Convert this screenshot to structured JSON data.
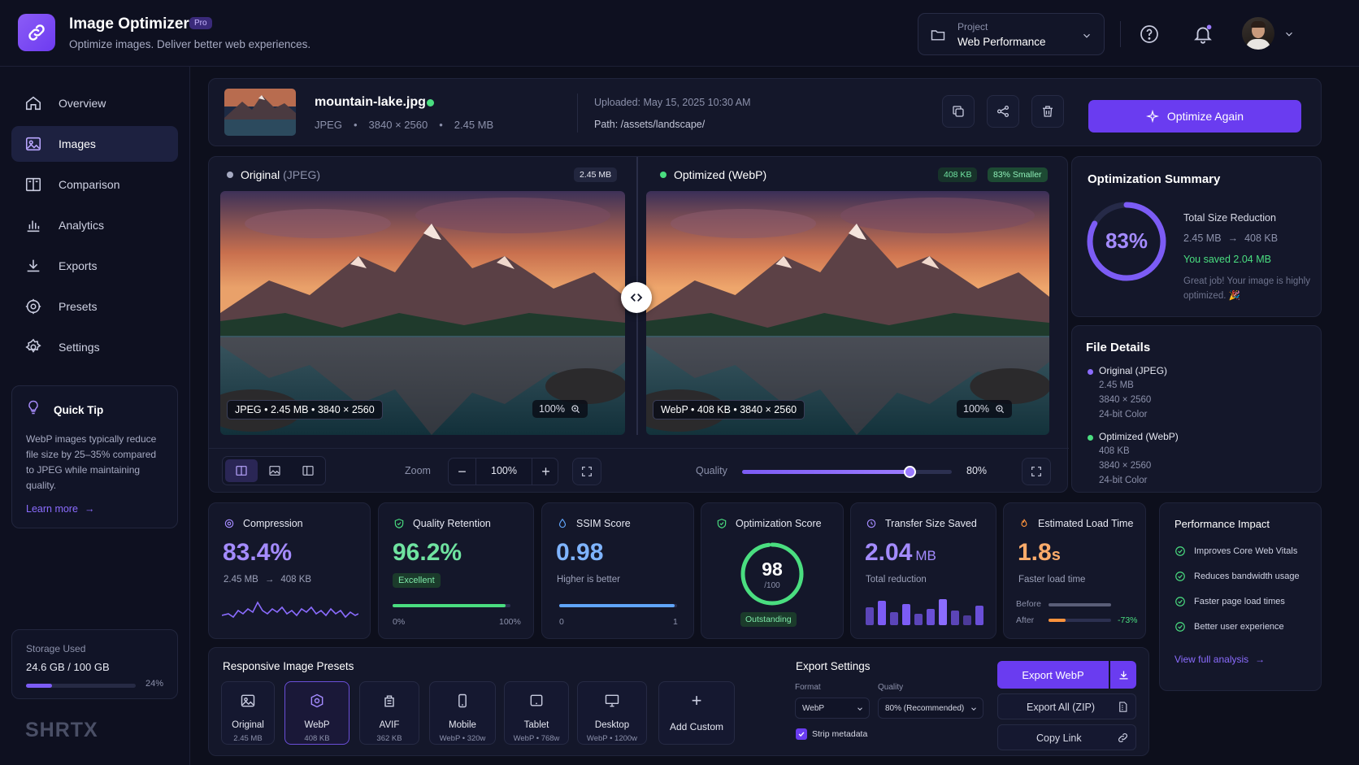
{
  "app": {
    "title": "Image Optimizer",
    "badge": "Pro",
    "subtitle": "Optimize images. Deliver better web experiences."
  },
  "project": {
    "label": "Project",
    "name": "Web Performance"
  },
  "nav": {
    "overview": "Overview",
    "images": "Images",
    "comparison": "Comparison",
    "analytics": "Analytics",
    "exports": "Exports",
    "presets": "Presets",
    "settings": "Settings"
  },
  "tip": {
    "title": "Quick Tip",
    "body": "WebP images typically reduce file size by 25–35% compared to JPEG while maintaining quality.",
    "link": "Learn more"
  },
  "storage": {
    "label": "Storage Used",
    "value": "24.6 GB / 100 GB",
    "percent": "24%",
    "fraction": 0.24
  },
  "brand": "SHRTX",
  "file": {
    "name": "mountain-lake.jpg",
    "format": "JPEG",
    "dims": "3840 × 2560",
    "size": "2.45 MB",
    "uploaded": "Uploaded: May 15, 2025 10:30 AM",
    "path": "Path: /assets/landscape/"
  },
  "actions": {
    "optimize_again": "Optimize Again"
  },
  "compare": {
    "original": {
      "label": "Original",
      "format": "(JPEG)",
      "size": "2.45 MB",
      "info": "JPEG  •  2.45 MB  •  3840 × 2560",
      "zoom": "100%"
    },
    "optimized": {
      "label": "Optimized (WebP)",
      "size": "408 KB",
      "smaller": "83% Smaller",
      "info": "WebP  •  408 KB  •  3840 × 2560",
      "zoom": "100%"
    }
  },
  "toolbar": {
    "zoom_label": "Zoom",
    "zoom_value": "100%",
    "quality_label": "Quality",
    "quality_value": "80%",
    "quality_fraction": 0.8
  },
  "summary": {
    "title": "Optimization Summary",
    "percent": "83%",
    "fraction": 0.83,
    "reduction_label": "Total Size Reduction",
    "before": "2.45 MB",
    "after": "408 KB",
    "saved": "You saved 2.04 MB",
    "note": "Great job! Your image is highly optimized. 🎉"
  },
  "details": {
    "title": "File Details",
    "original": {
      "name": "Original (JPEG)",
      "size": "2.45 MB",
      "dims": "3840 × 2560",
      "color": "24-bit Color"
    },
    "optimized": {
      "name": "Optimized (WebP)",
      "size": "408 KB",
      "dims": "3840 × 2560",
      "color": "24-bit Color"
    }
  },
  "metrics": {
    "compression": {
      "title": "Compression",
      "value": "83.4%",
      "before": "2.45 MB",
      "after": "408 KB"
    },
    "quality": {
      "title": "Quality Retention",
      "value": "96.2%",
      "badge": "Excellent",
      "min": "0%",
      "max": "100%",
      "fraction": 0.962
    },
    "ssim": {
      "title": "SSIM Score",
      "value": "0.98",
      "sub": "Higher is better",
      "min": "0",
      "max": "1",
      "fraction": 0.98
    },
    "opt_score": {
      "title": "Optimization Score",
      "value": "98",
      "denom": "/100",
      "badge": "Outstanding",
      "fraction": 0.98
    },
    "transfer": {
      "title": "Transfer Size Saved",
      "value": "2.04",
      "unit": "MB",
      "sub": "Total reduction"
    },
    "load": {
      "title": "Estimated Load Time",
      "value": "1.8",
      "unit": "s",
      "sub": "Faster load time",
      "before_label": "Before",
      "after_label": "After",
      "delta": "-73%",
      "after_fraction": 0.27
    }
  },
  "impact": {
    "title": "Performance Impact",
    "items": [
      "Improves Core Web Vitals",
      "Reduces bandwidth usage",
      "Faster page load times",
      "Better user experience"
    ],
    "link": "View full analysis"
  },
  "presets": {
    "title": "Responsive Image Presets",
    "items": [
      {
        "name": "Original",
        "sub": "2.45 MB"
      },
      {
        "name": "WebP",
        "sub": "408 KB"
      },
      {
        "name": "AVIF",
        "sub": "362 KB"
      },
      {
        "name": "Mobile",
        "sub": "WebP • 320w"
      },
      {
        "name": "Tablet",
        "sub": "WebP • 768w"
      },
      {
        "name": "Desktop",
        "sub": "WebP • 1200w"
      }
    ],
    "add": "Add Custom"
  },
  "export": {
    "title": "Export Settings",
    "format_label": "Format",
    "format_value": "WebP",
    "quality_label": "Quality",
    "quality_value": "80% (Recommended)",
    "strip": "Strip metadata",
    "export_webp": "Export WebP",
    "export_all": "Export All (ZIP)",
    "copy_link": "Copy Link"
  },
  "colors": {
    "accent": "#6a3cf0",
    "purple": "#8b6cff",
    "green": "#4ade80",
    "blue": "#60a5fa",
    "orange": "#fb923c"
  }
}
